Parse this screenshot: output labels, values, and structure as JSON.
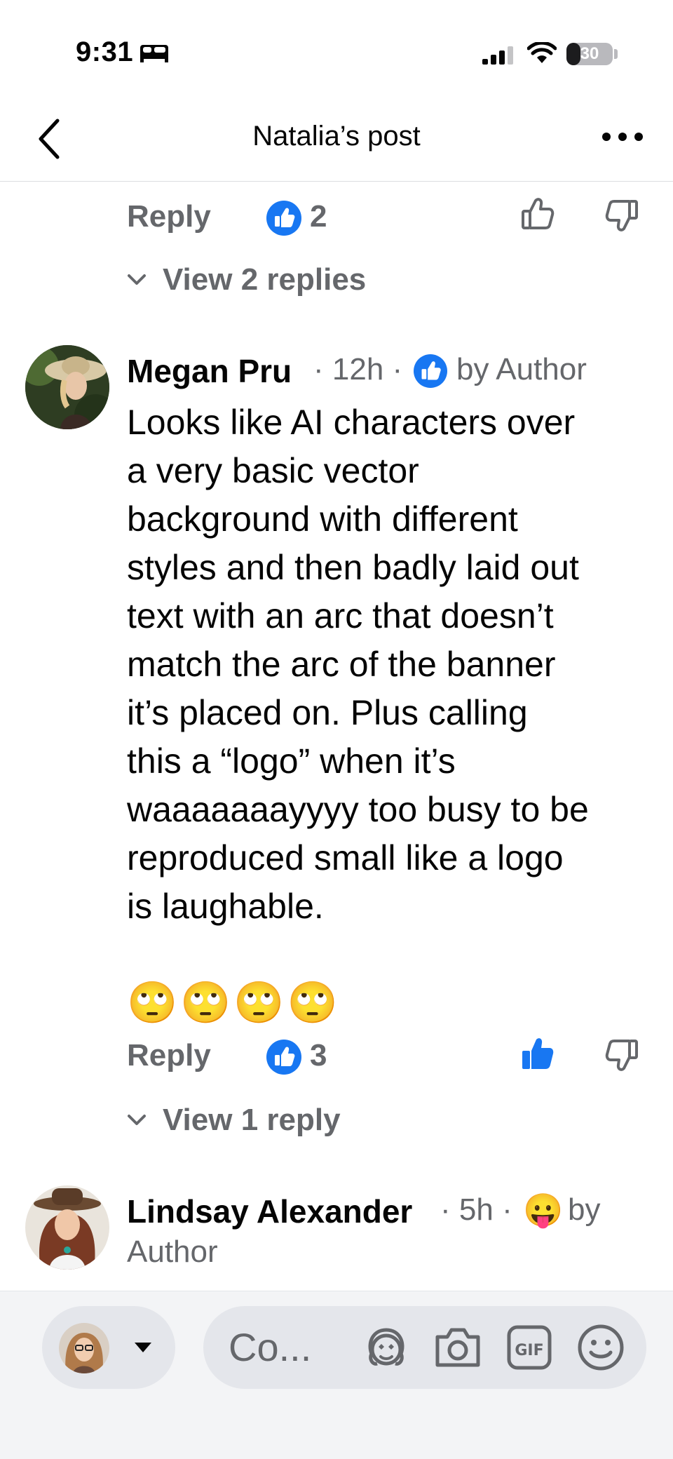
{
  "status_bar": {
    "time": "9:31",
    "battery": "30",
    "battery_level": 0.3
  },
  "header": {
    "title": "Natalia’s post"
  },
  "top_action_row": {
    "reply_label": "Reply",
    "like_count": "2"
  },
  "top_view_replies": "View 2 replies",
  "comment_1": {
    "author": "Megan Pru",
    "time": "12h",
    "reaction_label": "by Author",
    "text_lines": [
      "Looks like AI characters over",
      "a very basic vector",
      "background with different",
      "styles and then badly laid out",
      "text with an arc that doesn’t",
      "match the arc of the banner",
      "it’s placed on. Plus calling",
      "this a “logo” when it’s",
      "waaaaaaayyyy too busy to be",
      "reproduced small like a logo",
      "is laughable."
    ],
    "emojis": "🙄🙄🙄🙄",
    "reply_label": "Reply",
    "like_count": "3",
    "view_replies": "View 1 reply"
  },
  "comment_2": {
    "author": "Lindsay Alexander",
    "time": "5h",
    "reaction_emoji": "😛",
    "reaction_label_part1": "by",
    "reaction_label_part2": "Author"
  },
  "composer": {
    "placeholder": "Co..."
  },
  "colors": {
    "facebook_blue": "#1877f2",
    "secondary_text": "#65676b"
  }
}
